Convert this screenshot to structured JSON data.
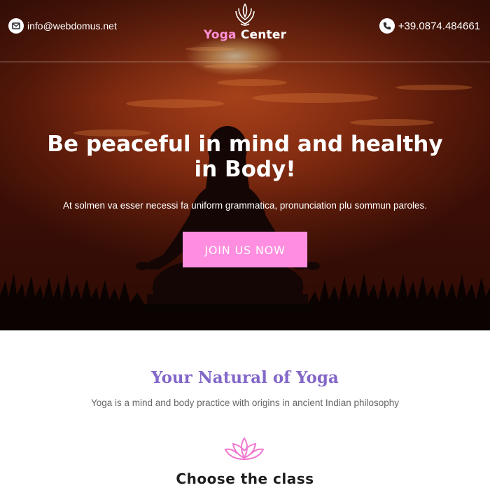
{
  "header": {
    "email": "info@webdomus.net",
    "phone": "+39.0874.484661",
    "logo": {
      "word1": "Yoga",
      "word2": "Center"
    }
  },
  "hero": {
    "headline": "Be peaceful in mind and healthy in Body!",
    "subline": "At solmen va esser necessi fa uniform grammatica, pronunciation plu sommun paroles.",
    "cta_label": "JOIN US NOW"
  },
  "intro": {
    "title": "Your Natural of Yoga",
    "subtitle": "Yoga is a mind and body practice with origins in ancient Indian philosophy",
    "class_heading": "Choose the class"
  },
  "colors": {
    "accent_pink": "#ff8ee0",
    "title_purple": "#8267c9",
    "hero_dark": "#3a0e06"
  },
  "icons": {
    "email": "envelope-icon",
    "phone": "phone-icon",
    "logo": "lotus-hands-icon",
    "section": "lotus-icon"
  }
}
